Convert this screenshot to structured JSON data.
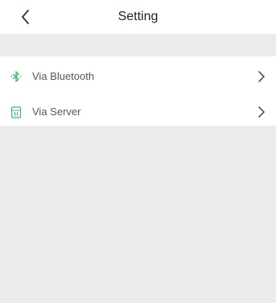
{
  "header": {
    "title": "Setting",
    "back_icon": "chevron-left-icon"
  },
  "settings": {
    "items": [
      {
        "label": "Via Bluetooth",
        "icon": "bluetooth-icon",
        "chevron": "chevron-right-icon"
      },
      {
        "label": "Via Server",
        "icon": "server-icon",
        "chevron": "chevron-right-icon"
      }
    ]
  },
  "colors": {
    "accent": "#3dbb6a",
    "background": "#ececee",
    "surface": "#ffffff"
  }
}
